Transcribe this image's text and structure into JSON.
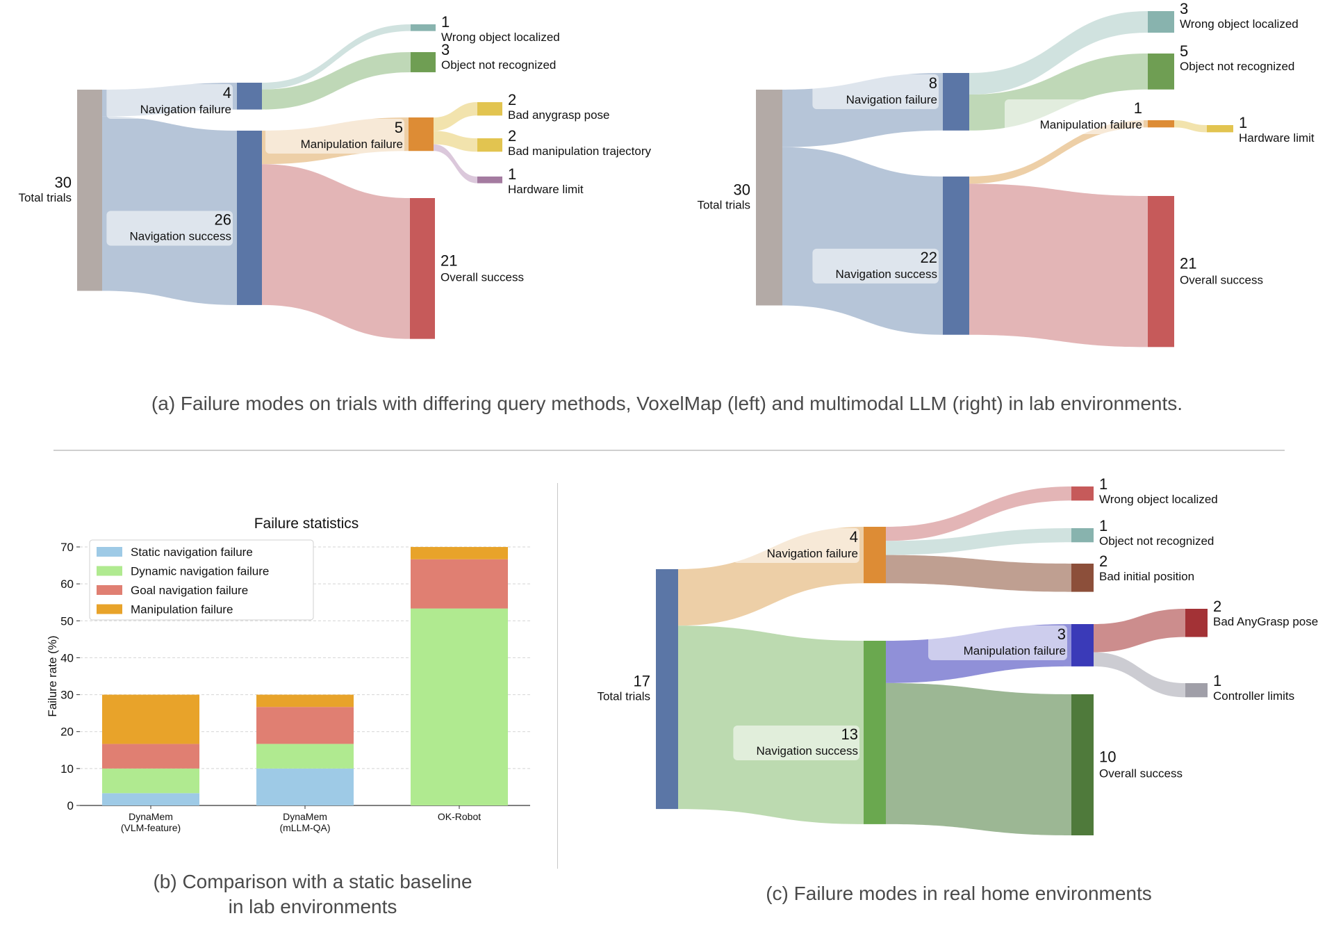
{
  "captions": {
    "a": "(a) Failure modes on trials with differing query methods, VoxelMap (left) and multimodal LLM (right) in lab environments.",
    "b_line1": "(b) Comparison with a static baseline",
    "b_line2": "in lab environments",
    "c": "(c) Failure modes in real home environments"
  },
  "chart_data": [
    {
      "id": "sankey-voxelmap",
      "type": "sankey",
      "title": "VoxelMap (left)",
      "nodes": [
        {
          "id": "total",
          "label": "Total trials",
          "value": 30,
          "color": "#b3aaa6"
        },
        {
          "id": "nav_fail",
          "label": "Navigation failure",
          "value": 4,
          "color": "#5b76a6"
        },
        {
          "id": "nav_succ",
          "label": "Navigation success",
          "value": 26,
          "color": "#5b76a6"
        },
        {
          "id": "wrong_obj",
          "label": "Wrong object localized",
          "value": 1,
          "color": "#88b3ae"
        },
        {
          "id": "not_recog",
          "label": "Object not recognized",
          "value": 3,
          "color": "#6f9e53"
        },
        {
          "id": "manip_fail",
          "label": "Manipulation failure",
          "value": 5,
          "color": "#dd8c35"
        },
        {
          "id": "bad_grasp",
          "label": "Bad anygrasp pose",
          "value": 2,
          "color": "#e2c450"
        },
        {
          "id": "bad_traj",
          "label": "Bad manipulation trajectory",
          "value": 2,
          "color": "#e2c450"
        },
        {
          "id": "hw_limit",
          "label": "Hardware limit",
          "value": 1,
          "color": "#a47ba0"
        },
        {
          "id": "overall",
          "label": "Overall success",
          "value": 21,
          "color": "#c65a5a"
        }
      ],
      "links": [
        {
          "source": "total",
          "target": "nav_fail",
          "value": 4,
          "color": "#b2c2d6"
        },
        {
          "source": "total",
          "target": "nav_succ",
          "value": 26,
          "color": "#b2c2d6"
        },
        {
          "source": "nav_fail",
          "target": "wrong_obj",
          "value": 1,
          "color": "#cde0dd"
        },
        {
          "source": "nav_fail",
          "target": "not_recog",
          "value": 3,
          "color": "#bcd6b3"
        },
        {
          "source": "nav_succ",
          "target": "manip_fail",
          "value": 5,
          "color": "#eccca2"
        },
        {
          "source": "nav_succ",
          "target": "overall",
          "value": 21,
          "color": "#e1b1b2"
        },
        {
          "source": "manip_fail",
          "target": "bad_grasp",
          "value": 2,
          "color": "#f1e2a9"
        },
        {
          "source": "manip_fail",
          "target": "bad_traj",
          "value": 2,
          "color": "#f1e2a9"
        },
        {
          "source": "manip_fail",
          "target": "hw_limit",
          "value": 1,
          "color": "#d9c5d9"
        }
      ]
    },
    {
      "id": "sankey-mllm",
      "type": "sankey",
      "title": "multimodal LLM (right)",
      "nodes": [
        {
          "id": "total",
          "label": "Total trials",
          "value": 30,
          "color": "#b3aaa6"
        },
        {
          "id": "nav_fail",
          "label": "Navigation failure",
          "value": 8,
          "color": "#5b76a6"
        },
        {
          "id": "nav_succ",
          "label": "Navigation success",
          "value": 22,
          "color": "#5b76a6"
        },
        {
          "id": "wrong_obj",
          "label": "Wrong object localized",
          "value": 3,
          "color": "#88b3ae"
        },
        {
          "id": "not_recog",
          "label": "Object not recognized",
          "value": 5,
          "color": "#6f9e53"
        },
        {
          "id": "manip_fail",
          "label": "Manipulation failure",
          "value": 1,
          "color": "#dd8c35"
        },
        {
          "id": "hw_limit",
          "label": "Hardware limit",
          "value": 1,
          "color": "#e2c450"
        },
        {
          "id": "overall",
          "label": "Overall success",
          "value": 21,
          "color": "#c65a5a"
        }
      ],
      "links": [
        {
          "source": "total",
          "target": "nav_fail",
          "value": 8,
          "color": "#b2c2d6"
        },
        {
          "source": "total",
          "target": "nav_succ",
          "value": 22,
          "color": "#b2c2d6"
        },
        {
          "source": "nav_fail",
          "target": "wrong_obj",
          "value": 3,
          "color": "#cde0dd"
        },
        {
          "source": "nav_fail",
          "target": "not_recog",
          "value": 5,
          "color": "#bcd6b3"
        },
        {
          "source": "nav_succ",
          "target": "manip_fail",
          "value": 1,
          "color": "#eccca2"
        },
        {
          "source": "nav_succ",
          "target": "overall",
          "value": 21,
          "color": "#e1b1b2"
        },
        {
          "source": "manip_fail",
          "target": "hw_limit",
          "value": 1,
          "color": "#f1e2a9"
        }
      ]
    },
    {
      "id": "bar-failure-stats",
      "type": "bar",
      "stacked": true,
      "title": "Failure statistics",
      "xlabel": "",
      "ylabel": "Failure rate (%)",
      "ylim": [
        0,
        70
      ],
      "yticks": [
        0,
        10,
        20,
        30,
        40,
        50,
        60,
        70
      ],
      "grid": true,
      "legend": "top-left",
      "categories": [
        "DynaMem\n(VLM-feature)",
        "DynaMem\n(mLLM-QA)",
        "OK-Robot"
      ],
      "series": [
        {
          "name": "Static navigation failure",
          "color": "#9ecae6",
          "values": [
            3.33,
            10.0,
            0.0
          ]
        },
        {
          "name": "Dynamic navigation failure",
          "color": "#b0ea90",
          "values": [
            6.67,
            6.67,
            53.33
          ]
        },
        {
          "name": "Goal navigation failure",
          "color": "#e07f72",
          "values": [
            6.67,
            10.0,
            13.33
          ]
        },
        {
          "name": "Manipulation failure",
          "color": "#e8a32a",
          "values": [
            13.33,
            3.33,
            3.33
          ]
        }
      ]
    },
    {
      "id": "sankey-home",
      "type": "sankey",
      "title": "real home environments",
      "nodes": [
        {
          "id": "total",
          "label": "Total trials",
          "value": 17,
          "color": "#5b76a6"
        },
        {
          "id": "nav_fail",
          "label": "Navigation failure",
          "value": 4,
          "color": "#dd8c35"
        },
        {
          "id": "nav_succ",
          "label": "Navigation success",
          "value": 13,
          "color": "#6aa84f"
        },
        {
          "id": "wrong_obj",
          "label": "Wrong object localized",
          "value": 1,
          "color": "#c65a5a"
        },
        {
          "id": "not_recog",
          "label": "Object not recognized",
          "value": 1,
          "color": "#88b3ae"
        },
        {
          "id": "bad_init",
          "label": "Bad initial position",
          "value": 2,
          "color": "#8c4f3a"
        },
        {
          "id": "manip_fail",
          "label": "Manipulation failure",
          "value": 3,
          "color": "#3a3ab8"
        },
        {
          "id": "bad_grasp",
          "label": "Bad AnyGrasp pose",
          "value": 2,
          "color": "#a33236"
        },
        {
          "id": "ctrl_limit",
          "label": "Controller limits",
          "value": 1,
          "color": "#a09fa8"
        },
        {
          "id": "overall",
          "label": "Overall success",
          "value": 10,
          "color": "#4f7a3b"
        }
      ],
      "links": [
        {
          "source": "total",
          "target": "nav_fail",
          "value": 4,
          "color": "#eccca2"
        },
        {
          "source": "total",
          "target": "nav_succ",
          "value": 13,
          "color": "#b8d8ac"
        },
        {
          "source": "nav_fail",
          "target": "wrong_obj",
          "value": 1,
          "color": "#e1b1b2"
        },
        {
          "source": "nav_fail",
          "target": "not_recog",
          "value": 1,
          "color": "#cde0dd"
        },
        {
          "source": "nav_fail",
          "target": "bad_init",
          "value": 2,
          "color": "#bc9a8b"
        },
        {
          "source": "nav_succ",
          "target": "manip_fail",
          "value": 3,
          "color": "#8a8ad6"
        },
        {
          "source": "nav_succ",
          "target": "overall",
          "value": 10,
          "color": "#97b38e"
        },
        {
          "source": "manip_fail",
          "target": "bad_grasp",
          "value": 2,
          "color": "#c98787"
        },
        {
          "source": "manip_fail",
          "target": "ctrl_limit",
          "value": 1,
          "color": "#c9c9d0"
        }
      ]
    }
  ]
}
